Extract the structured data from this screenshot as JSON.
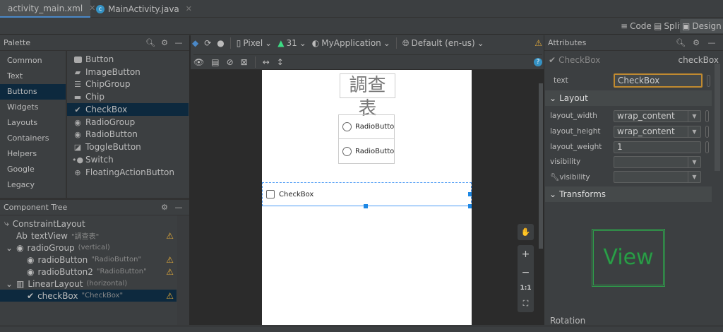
{
  "tabs": [
    {
      "label": "activity_main.xml",
      "icon": "xml-layout-icon",
      "active": true
    },
    {
      "label": "MainActivity.java",
      "icon": "java-class-icon",
      "active": false
    }
  ],
  "view_modes": [
    {
      "label": "Code",
      "icon": "code-lines-icon"
    },
    {
      "label": "Split",
      "icon": "split-icon"
    },
    {
      "label": "Design",
      "icon": "image-icon",
      "active": true
    }
  ],
  "palette": {
    "title": "Palette",
    "categories": [
      "Common",
      "Text",
      "Buttons",
      "Widgets",
      "Layouts",
      "Containers",
      "Helpers",
      "Google",
      "Legacy"
    ],
    "selected_category": "Buttons",
    "items": [
      {
        "label": "Button",
        "icon": "button-icon"
      },
      {
        "label": "ImageButton",
        "icon": "image-button-icon"
      },
      {
        "label": "ChipGroup",
        "icon": "chip-group-icon"
      },
      {
        "label": "Chip",
        "icon": "chip-icon"
      },
      {
        "label": "CheckBox",
        "icon": "checkbox-icon",
        "selected": true
      },
      {
        "label": "RadioGroup",
        "icon": "radio-group-icon"
      },
      {
        "label": "RadioButton",
        "icon": "radio-button-icon"
      },
      {
        "label": "ToggleButton",
        "icon": "toggle-button-icon"
      },
      {
        "label": "Switch",
        "icon": "switch-icon"
      },
      {
        "label": "FloatingActionButton",
        "icon": "fab-icon"
      }
    ]
  },
  "component_tree": {
    "title": "Component Tree",
    "nodes": [
      {
        "label": "ConstraintLayout",
        "hint": "",
        "icon": "constraint-layout-icon",
        "warn": false
      },
      {
        "label": "textView",
        "hint": "\"調查表\"",
        "icon": "text-view-icon",
        "prefix": "Ab",
        "warn": true
      },
      {
        "label": "radioGroup",
        "hint": "(vertical)",
        "icon": "radio-group-icon",
        "warn": false
      },
      {
        "label": "radioButton",
        "hint": "\"RadioButton\"",
        "icon": "radio-button-icon",
        "warn": true
      },
      {
        "label": "radioButton2",
        "hint": "\"RadioButton\"",
        "icon": "radio-button-icon",
        "warn": true
      },
      {
        "label": "LinearLayout",
        "hint": "(horizontal)",
        "icon": "linear-layout-icon",
        "warn": false
      },
      {
        "label": "checkBox",
        "hint": "\"CheckBox\"",
        "icon": "checkbox-icon",
        "warn": true,
        "selected": true
      }
    ]
  },
  "toolbar": {
    "device": "Pixel",
    "api": "31",
    "theme": "MyApplication",
    "locale": "Default (en-us)"
  },
  "preview": {
    "title": "調查表",
    "radio1": "RadioButton",
    "radio2": "RadioButton",
    "checkbox": "CheckBox"
  },
  "zoom_controls": {
    "fit_label": "1:1"
  },
  "attributes": {
    "title": "Attributes",
    "widget": "CheckBox",
    "id": "checkBox",
    "text_label": "text",
    "text_value": "CheckBox",
    "layout_section": "Layout",
    "rows": [
      {
        "label": "layout_width",
        "value": "wrap_content",
        "dropdown": true
      },
      {
        "label": "layout_height",
        "value": "wrap_content",
        "dropdown": true
      },
      {
        "label": "layout_weight",
        "value": "1",
        "dropdown": false
      },
      {
        "label": "visibility",
        "value": "",
        "dropdown": true
      },
      {
        "label": "visibility",
        "value": "",
        "dropdown": true,
        "tools": true
      }
    ],
    "transforms_section": "Transforms",
    "view_preview": "View",
    "rotation_label": "Rotation"
  },
  "colors": {
    "accent": "#4a88c7",
    "selection": "#0d293e",
    "warning": "#e0a93b",
    "android": "#3ddc84",
    "view_green": "#2e9c4a",
    "text_focus": "#c08a30"
  }
}
